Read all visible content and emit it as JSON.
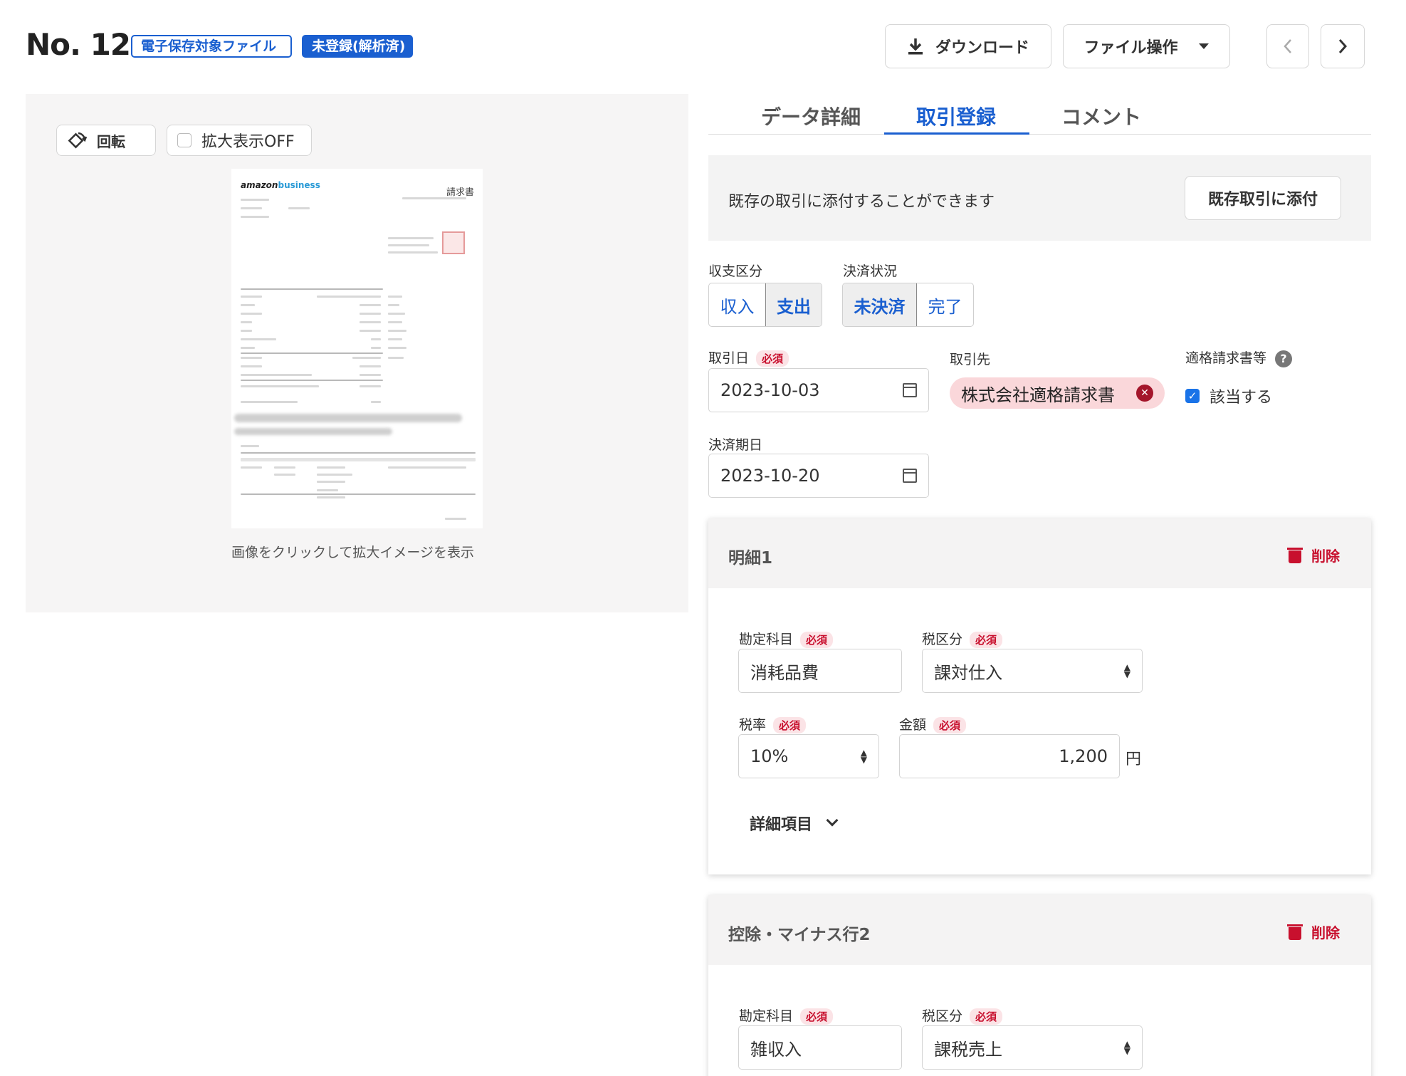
{
  "header": {
    "title": "No. 12",
    "badge_outline": "電子保存対象ファイル",
    "badge_solid": "未登録(解析済)",
    "download_label": "ダウンロード",
    "file_ops_label": "ファイル操作"
  },
  "preview": {
    "rotate_label": "回転",
    "zoom_label": "拡大表示OFF",
    "doc_logo_a": "amazon",
    "doc_logo_b": "business",
    "doc_title": "請求書",
    "caption": "画像をクリックして拡大イメージを表示"
  },
  "tabs": [
    {
      "label": "データ詳細",
      "active": false
    },
    {
      "label": "取引登録",
      "active": true
    },
    {
      "label": "コメント",
      "active": false
    }
  ],
  "attach": {
    "text": "既存の取引に添付することができます",
    "button": "既存取引に添付"
  },
  "form": {
    "kind_label": "収支区分",
    "kind_options": [
      "収入",
      "支出"
    ],
    "kind_selected": "支出",
    "status_label": "決済状況",
    "status_options": [
      "未決済",
      "完了"
    ],
    "status_selected": "未決済",
    "date_label": "取引日",
    "required": "必須",
    "date_value": "2023-10-03",
    "partner_label": "取引先",
    "partner_value": "株式会社適格請求書",
    "invoice_label": "適格請求書等",
    "invoice_check_label": "該当する",
    "invoice_checked": true,
    "due_label": "決済期日",
    "due_value": "2023-10-20"
  },
  "items": [
    {
      "title": "明細1",
      "delete": "削除",
      "account_label": "勘定科目",
      "account_value": "消耗品費",
      "tax_label": "税区分",
      "tax_value": "課対仕入",
      "rate_label": "税率",
      "rate_value": "10%",
      "amount_label": "金額",
      "amount_value": "1,200",
      "currency": "円",
      "detail_toggle": "詳細項目"
    },
    {
      "title": "控除・マイナス行2",
      "delete": "削除",
      "account_label": "勘定科目",
      "account_value": "雑収入",
      "tax_label": "税区分",
      "tax_value": "課税売上"
    }
  ],
  "colors": {
    "accent": "#1a5fd0",
    "danger": "#c8102e",
    "chip_bg": "#fad7da"
  }
}
